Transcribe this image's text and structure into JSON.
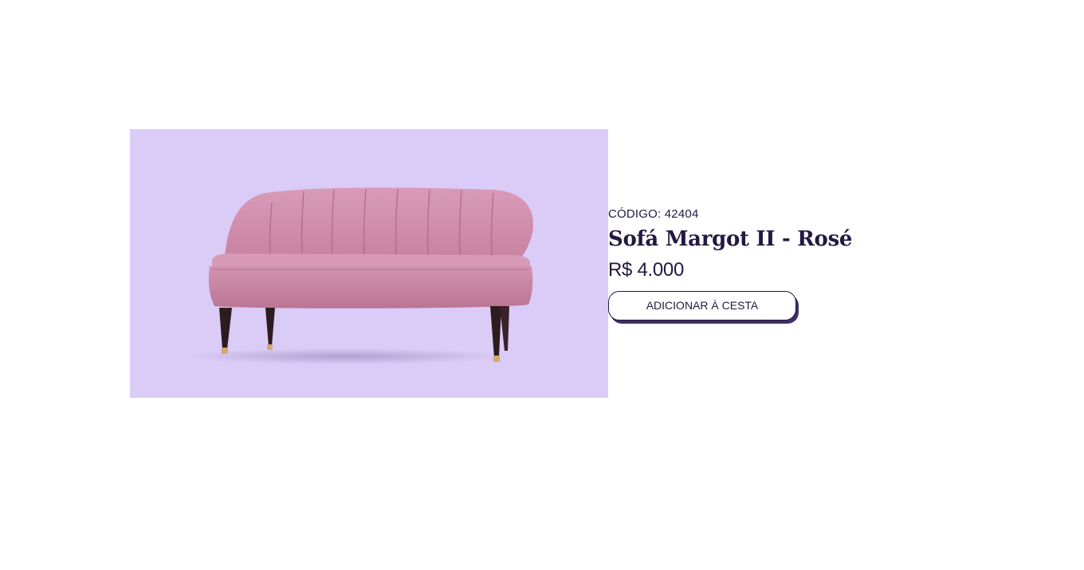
{
  "product": {
    "code_label": "CÓDIGO: 42404",
    "name": "Sofá Margot II - Rosé",
    "price": "R$ 4.000",
    "add_to_cart_label": "ADICIONAR À CESTA",
    "image_background": "#dacbf7",
    "sofa_color": "#c98aa8"
  },
  "colors": {
    "text": "#231942",
    "button_shadow": "#3d2f63"
  }
}
